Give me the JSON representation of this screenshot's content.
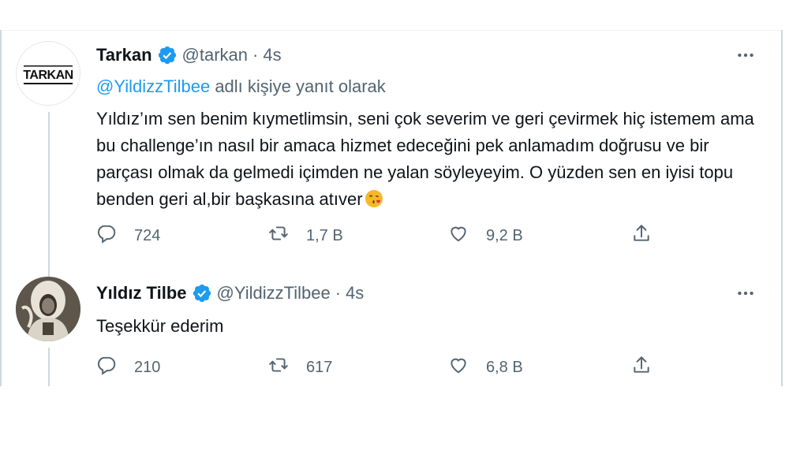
{
  "tweets": [
    {
      "name": "Tarkan",
      "handle": "@tarkan",
      "separator": "·",
      "time": "4s",
      "reply_to_mention": "@YildizzTilbee",
      "reply_to_suffix": " adlı kişiye yanıt olarak",
      "text": "Yıldız’ım sen benim kıymetlimsin, seni çok severim ve geri çevirmek hiç istemem ama bu challenge’ın nasıl bir amaca hizmet edeceğini pek anlamadım doğrusu ve bir parçası olmak da gelmedi içimden ne yalan söyleyeyim. O yüzden sen en iyisi topu benden geri al,bir başkasına atıver",
      "avatar_text": "TARKAN",
      "emoji": "kissing-face-emoji",
      "replies": "724",
      "retweets": "1,7 B",
      "likes": "9,2 B"
    },
    {
      "name": "Yıldız Tilbe",
      "handle": "@YildizzTilbee",
      "separator": "·",
      "time": "4s",
      "text": "Teşekkür ederim",
      "replies": "210",
      "retweets": "617",
      "likes": "6,8 B"
    }
  ],
  "icons": {
    "verified": "verified-badge-icon",
    "more": "more-dots-icon",
    "reply": "reply-bubble-icon",
    "retweet": "retweet-icon",
    "like": "heart-icon",
    "share": "share-icon"
  },
  "colors": {
    "accent": "#1d9bf0",
    "text": "#0f1419",
    "muted": "#536471",
    "border": "#cfd9de"
  }
}
